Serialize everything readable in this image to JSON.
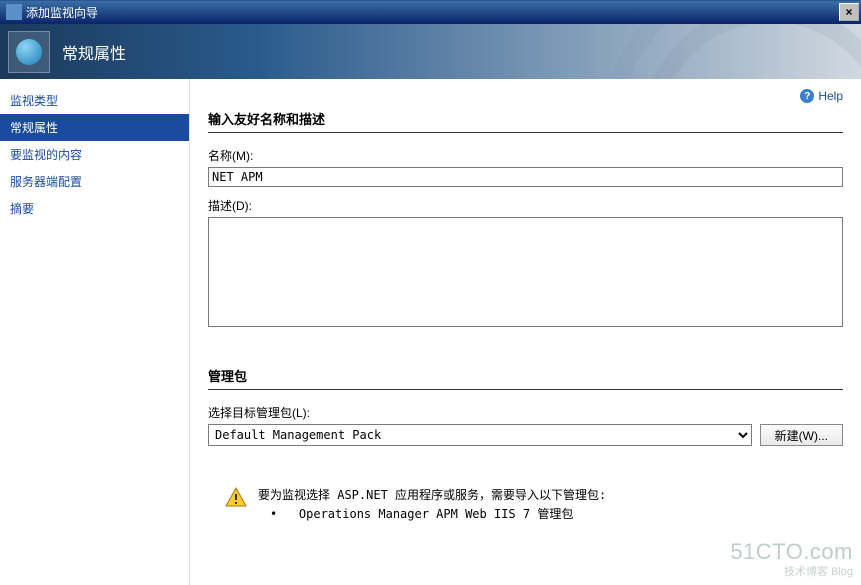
{
  "window": {
    "title": "添加监视向导",
    "close_label": "×"
  },
  "header": {
    "title": "常规属性"
  },
  "sidebar": {
    "items": [
      {
        "label": "监视类型"
      },
      {
        "label": "常规属性"
      },
      {
        "label": "要监视的内容"
      },
      {
        "label": "服务器端配置"
      },
      {
        "label": "摘要"
      }
    ]
  },
  "help": {
    "label": "Help"
  },
  "form": {
    "section1_title": "输入友好名称和描述",
    "name_label": "名称(M):",
    "name_value": "NET APM",
    "desc_label": "描述(D):",
    "desc_value": "",
    "mgmt_title": "管理包",
    "mgmt_label": "选择目标管理包(L):",
    "mgmt_selected": "Default Management Pack",
    "new_button": "新建(W)..."
  },
  "warning": {
    "line1": "要为监视选择 ASP.NET 应用程序或服务，需要导入以下管理包:",
    "line2": "Operations Manager APM Web IIS 7 管理包"
  },
  "watermark": {
    "main": "51CTO.com",
    "sub": "技术博客  Blog"
  }
}
